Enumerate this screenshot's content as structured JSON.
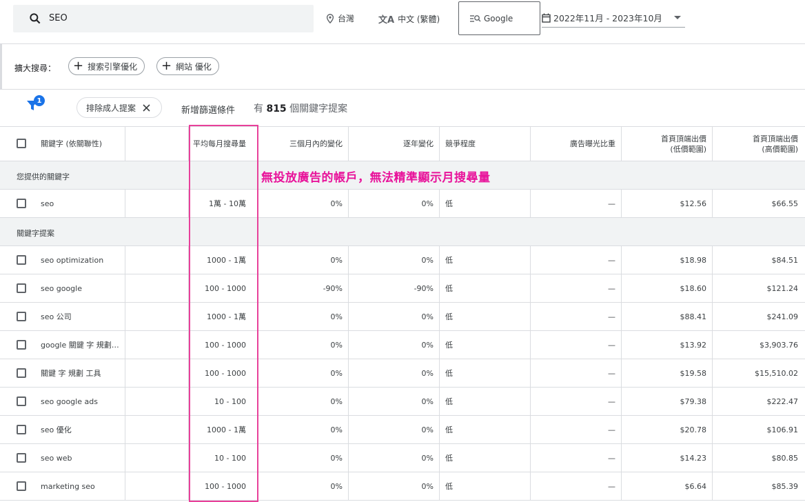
{
  "search": {
    "query": "SEO"
  },
  "location": {
    "label": "台灣"
  },
  "language": {
    "label": "中文 (繁體)"
  },
  "engine": {
    "label": "Google"
  },
  "date_range": {
    "label": "2022年11月 - 2023年10月"
  },
  "expand": {
    "label": "擴大搜尋：",
    "pills": [
      "搜索引擎優化",
      "網站 優化"
    ]
  },
  "filters": {
    "badge_count": "1",
    "chip_label": "排除成人提案",
    "add_filter": "新增篩選條件",
    "count_prefix": "有",
    "count_value": "815",
    "count_suffix": "個關鍵字提案"
  },
  "table": {
    "headers": {
      "keyword": "關鍵字 (依關聯性)",
      "avg": "平均每月搜尋量",
      "three_month": "三個月內的變化",
      "yoy": "逐年變化",
      "competition": "競爭程度",
      "impression": "廣告曝光比重",
      "bid_low_1": "首頁頂端出價",
      "bid_low_2": "(低價範圍)",
      "bid_high_1": "首頁頂端出價",
      "bid_high_2": "(高價範圍)"
    },
    "group_provided": "您提供的關鍵字",
    "group_ideas": "關鍵字提案",
    "provided": [
      {
        "kw": "seo",
        "avg": "1萬 - 10萬",
        "m3": "0%",
        "yoy": "0%",
        "comp": "低",
        "imp": "—",
        "low": "$12.56",
        "high": "$66.55"
      }
    ],
    "ideas": [
      {
        "kw": "seo optimization",
        "avg": "1000 - 1萬",
        "m3": "0%",
        "yoy": "0%",
        "comp": "低",
        "imp": "—",
        "low": "$18.98",
        "high": "$84.51"
      },
      {
        "kw": "seo google",
        "avg": "100 - 1000",
        "m3": "-90%",
        "yoy": "-90%",
        "comp": "低",
        "imp": "—",
        "low": "$18.60",
        "high": "$121.24"
      },
      {
        "kw": "seo 公司",
        "avg": "1000 - 1萬",
        "m3": "0%",
        "yoy": "0%",
        "comp": "低",
        "imp": "—",
        "low": "$88.41",
        "high": "$241.09"
      },
      {
        "kw": "google 關鍵 字 規劃…",
        "avg": "100 - 1000",
        "m3": "0%",
        "yoy": "0%",
        "comp": "低",
        "imp": "—",
        "low": "$13.92",
        "high": "$3,903.76"
      },
      {
        "kw": "關鍵 字 規劃 工具",
        "avg": "100 - 1000",
        "m3": "0%",
        "yoy": "0%",
        "comp": "低",
        "imp": "—",
        "low": "$19.58",
        "high": "$15,510.02"
      },
      {
        "kw": "seo google ads",
        "avg": "10 - 100",
        "m3": "0%",
        "yoy": "0%",
        "comp": "低",
        "imp": "—",
        "low": "$79.38",
        "high": "$222.47"
      },
      {
        "kw": "seo 優化",
        "avg": "1000 - 1萬",
        "m3": "0%",
        "yoy": "0%",
        "comp": "低",
        "imp": "—",
        "low": "$20.78",
        "high": "$106.91"
      },
      {
        "kw": "seo web",
        "avg": "10 - 100",
        "m3": "0%",
        "yoy": "0%",
        "comp": "低",
        "imp": "—",
        "low": "$14.23",
        "high": "$80.85"
      },
      {
        "kw": "marketing seo",
        "avg": "100 - 1000",
        "m3": "0%",
        "yoy": "0%",
        "comp": "低",
        "imp": "—",
        "low": "$6.64",
        "high": "$85.39"
      }
    ]
  },
  "annotation": {
    "text": "無投放廣告的帳戶，無法精準顯示月搜尋量"
  },
  "colors": {
    "accent": "#1a73e8",
    "annotation": "#e8139a"
  }
}
